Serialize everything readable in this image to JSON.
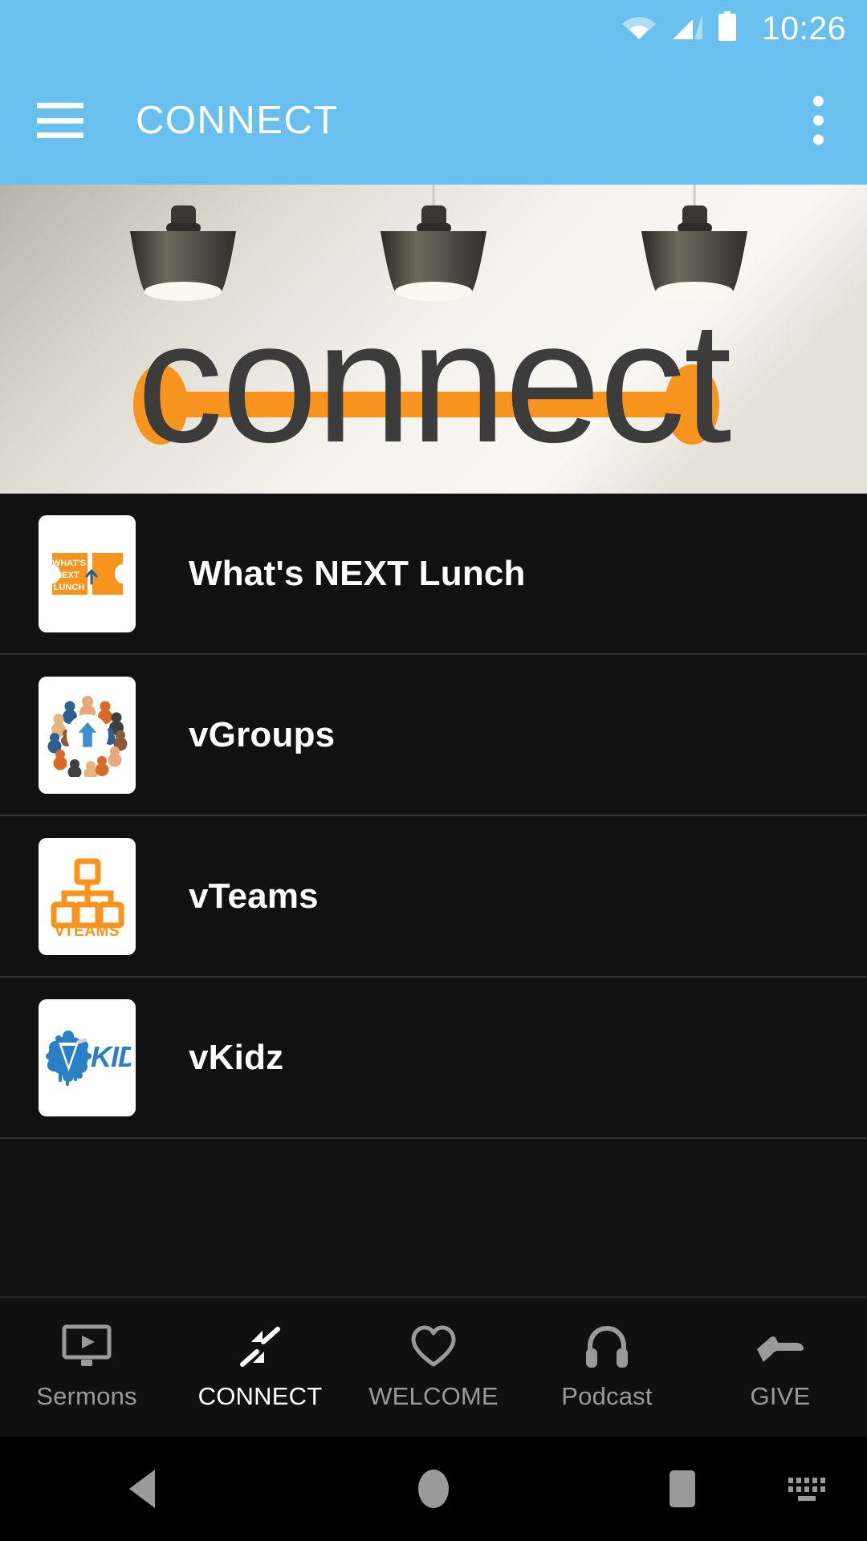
{
  "status_bar": {
    "time": "10:26",
    "icons": [
      "wifi-icon",
      "cellular-signal-icon",
      "battery-icon"
    ]
  },
  "toolbar": {
    "menu_icon": "hamburger-menu-icon",
    "title": "CONNECT",
    "overflow_icon": "overflow-menu-icon"
  },
  "banner": {
    "wordmark": "connect",
    "description": "Three pendant lamps above the word connect with an orange connector bar",
    "colors": {
      "orange": "#F7941E",
      "text_gray": "#3c3c3c"
    }
  },
  "list": {
    "items": [
      {
        "label": "What's NEXT Lunch",
        "icon": "ticket-icon",
        "icon_text": [
          "WHAT'S",
          "NEXT",
          "LUNCH"
        ],
        "icon_color": "#F7941E"
      },
      {
        "label": "vGroups",
        "icon": "people-circle-icon",
        "icon_color": "#3d8fd1"
      },
      {
        "label": "vTeams",
        "icon": "org-chart-icon",
        "icon_text": [
          "vTEAMS"
        ],
        "icon_color": "#F7941E"
      },
      {
        "label": "vKidz",
        "icon": "vkidz-logo-icon",
        "icon_text": [
          "VKIDZ"
        ],
        "icon_color": "#2b7fc4"
      }
    ]
  },
  "bottom_nav": {
    "items": [
      {
        "label": "Sermons",
        "icon": "video-monitor-icon",
        "active": false
      },
      {
        "label": "CONNECT",
        "icon": "compress-arrows-icon",
        "active": true
      },
      {
        "label": "WELCOME",
        "icon": "heart-icon",
        "active": false
      },
      {
        "label": "Podcast",
        "icon": "headphones-icon",
        "active": false
      },
      {
        "label": "GIVE",
        "icon": "giving-hand-icon",
        "active": false
      }
    ],
    "active_color": "#ffffff",
    "inactive_color": "#9a9a9a"
  },
  "android_nav": {
    "back": "back-triangle-icon",
    "home": "home-circle-icon",
    "recents": "recents-square-icon",
    "keyboard": "keyboard-indicator-icon"
  },
  "theme": {
    "accent_blue": "#69c0ee",
    "background_dark": "#111111",
    "divider": "#2e3135",
    "brand_orange": "#F7941E"
  }
}
